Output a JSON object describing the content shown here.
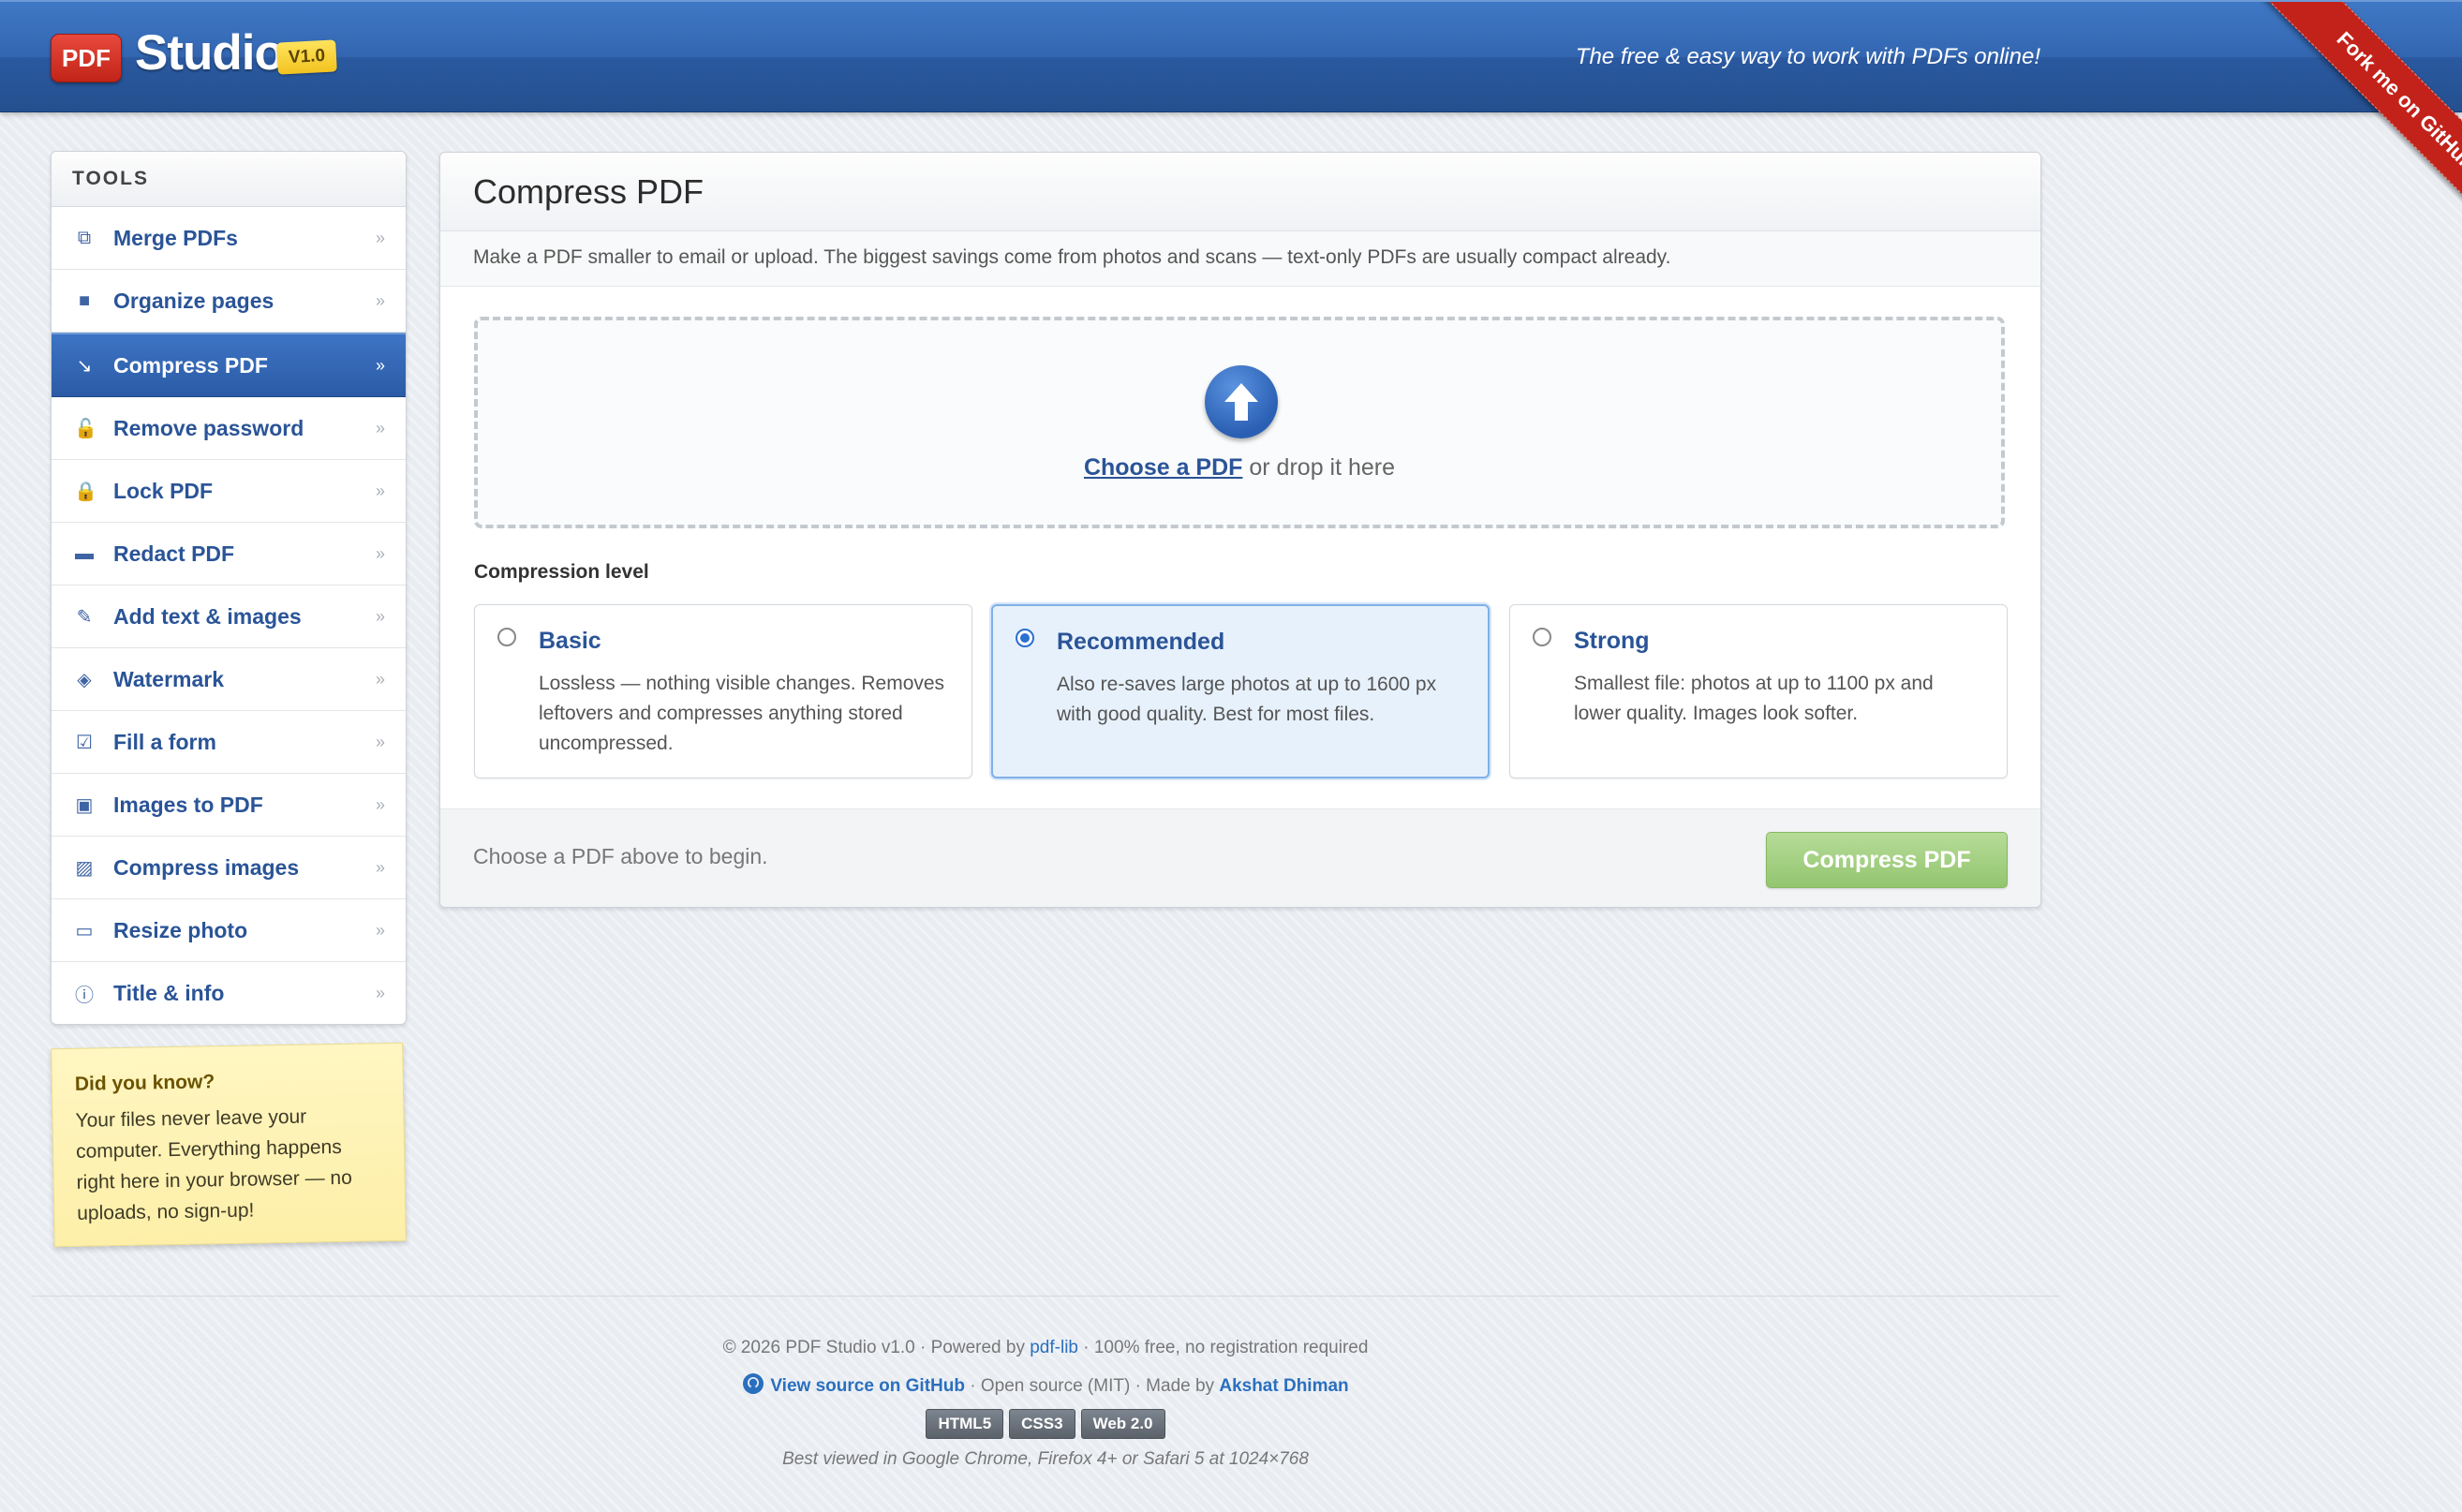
{
  "header": {
    "logo_badge": "PDF",
    "logo_text": "Studio",
    "version": "V1.0",
    "tagline": "The free & easy way to work with PDFs online!",
    "fork_ribbon": "Fork me on GitHub"
  },
  "sidebar": {
    "title": "TOOLS",
    "chevron": "»",
    "items": [
      {
        "label": "Merge PDFs",
        "icon": "⧉",
        "active": false
      },
      {
        "label": "Organize pages",
        "icon": "■",
        "active": false
      },
      {
        "label": "Compress PDF",
        "icon": "↘",
        "active": true
      },
      {
        "label": "Remove password",
        "icon": "🔓",
        "active": false
      },
      {
        "label": "Lock PDF",
        "icon": "🔒",
        "active": false
      },
      {
        "label": "Redact PDF",
        "icon": "▬",
        "active": false
      },
      {
        "label": "Add text & images",
        "icon": "✎",
        "active": false
      },
      {
        "label": "Watermark",
        "icon": "◈",
        "active": false
      },
      {
        "label": "Fill a form",
        "icon": "☑",
        "active": false
      },
      {
        "label": "Images to PDF",
        "icon": "▣",
        "active": false
      },
      {
        "label": "Compress images",
        "icon": "▨",
        "active": false
      },
      {
        "label": "Resize photo",
        "icon": "▭",
        "active": false
      },
      {
        "label": "Title & info",
        "icon": "ⓘ",
        "active": false
      }
    ]
  },
  "note": {
    "title": "Did you know?",
    "body": "Your files never leave your computer. Everything happens right here in your browser — no uploads, no sign-up!"
  },
  "main": {
    "title": "Compress PDF",
    "description": "Make a PDF smaller to email or upload. The biggest savings come from photos and scans — text-only PDFs are usually compact already.",
    "dropzone": {
      "link": "Choose a PDF",
      "suffix": " or drop it here"
    },
    "level_label": "Compression level",
    "options": [
      {
        "title": "Basic",
        "desc": "Lossless — nothing visible changes. Removes leftovers and compresses anything stored uncompressed.",
        "selected": false
      },
      {
        "title": "Recommended",
        "desc": "Also re-saves large photos at up to 1600 px with good quality. Best for most files.",
        "selected": true
      },
      {
        "title": "Strong",
        "desc": "Smallest file: photos at up to 1100 px and lower quality. Images look softer.",
        "selected": false
      }
    ],
    "status": "Choose a PDF above to begin.",
    "action_button": "Compress PDF"
  },
  "footer": {
    "line1_prefix": "© 2026 PDF Studio v1.0 · Powered by ",
    "line1_link": "pdf-lib",
    "line1_suffix": " · 100% free, no registration required",
    "line2_link": "View source on GitHub",
    "line2_middle": " · Open source (MIT) · Made by ",
    "line2_author": "Akshat Dhiman",
    "badges": [
      "HTML5",
      "CSS3",
      "Web 2.0"
    ],
    "line4": "Best viewed in Google Chrome, Firefox 4+ or Safari 5 at 1024×768"
  },
  "colors": {
    "header_blue": "#3366b1",
    "accent_link": "#2a5497",
    "ribbon_red": "#c3221a",
    "action_green": "#93c56f",
    "note_yellow": "#fdefa8"
  }
}
